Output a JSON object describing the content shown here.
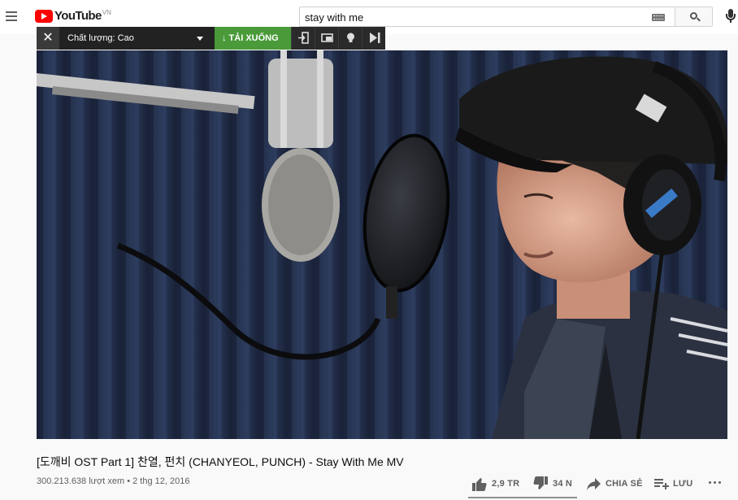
{
  "header": {
    "logo_text": "YouTube",
    "logo_country": "VN",
    "search_value": "stay with me",
    "icons": [
      "menu-icon",
      "youtube-logo",
      "keyboard-icon",
      "search-icon",
      "mic-icon"
    ]
  },
  "downloader": {
    "quality_label": "Chất lượng: Cao",
    "download_label": "↓ TẢI XUỐNG",
    "close_glyph": "✕",
    "tools": [
      "exit-icon",
      "popup-window-icon",
      "lightbulb-icon",
      "skip-end-icon"
    ]
  },
  "video": {
    "title": "[도깨비 OST Part 1] 찬열, 펀치 (CHANYEOL, PUNCH) - Stay With Me MV",
    "meta": "300.213.638 lượt xem • 2 thg 12, 2016"
  },
  "actions": {
    "like_count": "2,9 TR",
    "dislike_count": "34 N",
    "share_label": "CHIA SẺ",
    "save_label": "LƯU"
  },
  "colors": {
    "brand_red": "#ff0000",
    "download_green": "#4a9a3a",
    "toolbar_dark": "#222222",
    "text_secondary": "#606060"
  }
}
